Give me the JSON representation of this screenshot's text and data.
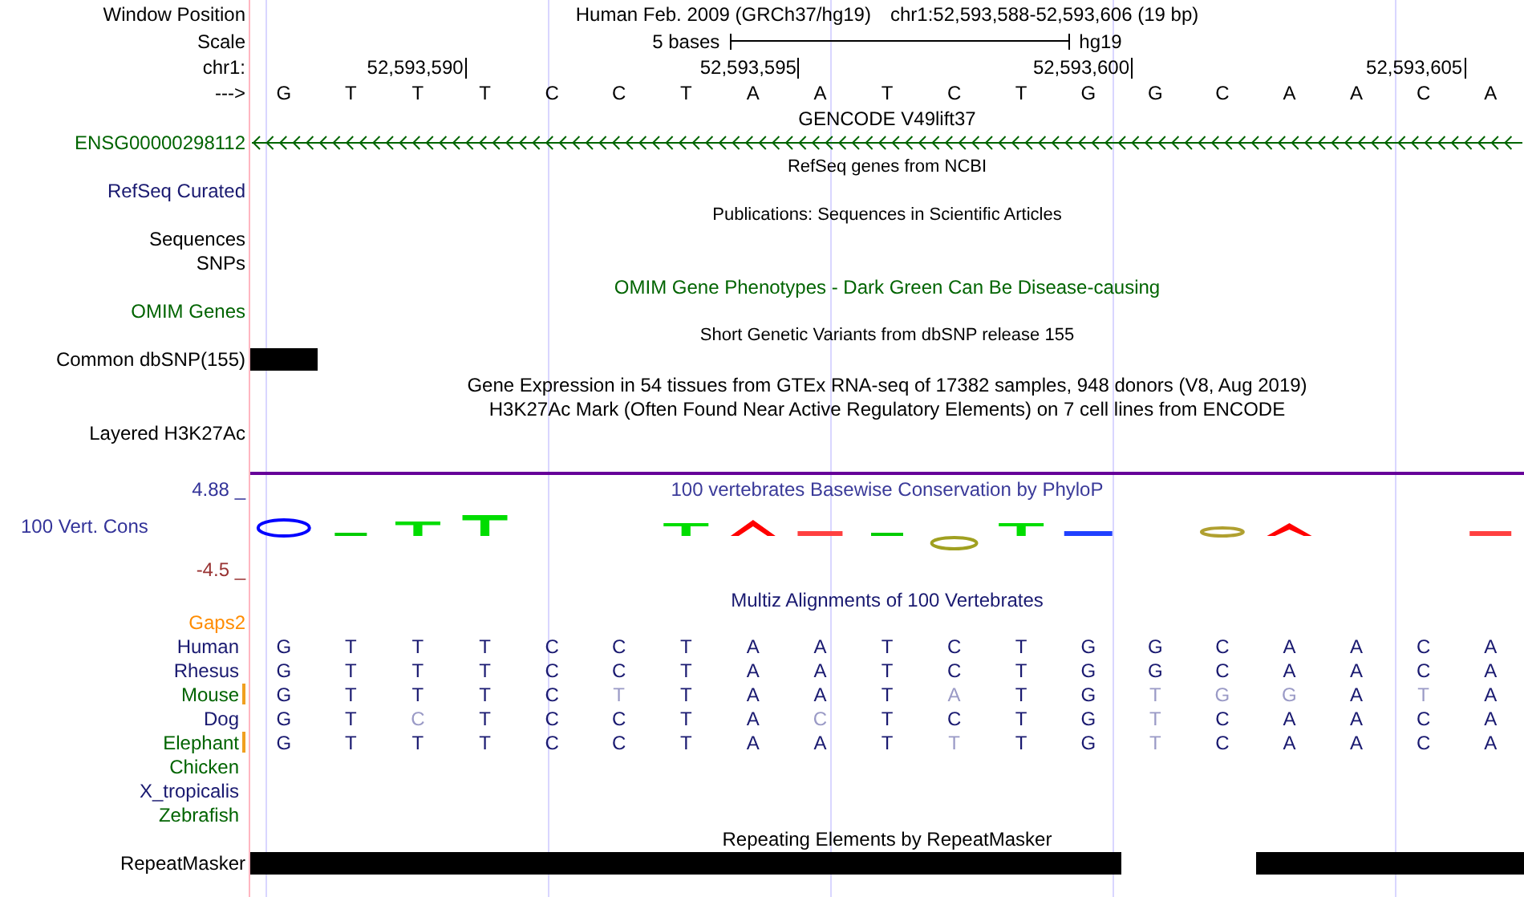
{
  "header": {
    "position_label": "Window Position",
    "assembly": "Human Feb. 2009 (GRCh37/hg19)",
    "position": "chr1:52,593,588-52,593,606 (19 bp)",
    "scale_label": "Scale",
    "scale_text": "5 bases",
    "scale_db": "hg19",
    "ruler_label": "chr1:",
    "strand_label": "--->",
    "bases": [
      {
        "base": "G"
      },
      {
        "base": "T"
      },
      {
        "base": "T",
        "tick": "52,593,590"
      },
      {
        "base": "T"
      },
      {
        "base": "C"
      },
      {
        "base": "C"
      },
      {
        "base": "T"
      },
      {
        "base": "A",
        "tick": "52,593,595"
      },
      {
        "base": "A"
      },
      {
        "base": "T"
      },
      {
        "base": "C"
      },
      {
        "base": "T"
      },
      {
        "base": "G",
        "tick": "52,593,600"
      },
      {
        "base": "G"
      },
      {
        "base": "C"
      },
      {
        "base": "A"
      },
      {
        "base": "A"
      },
      {
        "base": "C",
        "tick": "52,593,605"
      },
      {
        "base": "A"
      }
    ]
  },
  "tracks": [
    {
      "kind": "title",
      "text": "GENCODE V49lift37",
      "color": "#000000",
      "compact": false
    },
    {
      "kind": "gene",
      "label": "ENSG00000298112",
      "color": "#006400"
    },
    {
      "kind": "title",
      "text": "RefSeq genes from NCBI",
      "color": "#000000",
      "compact": true
    },
    {
      "kind": "label",
      "label": "RefSeq Curated",
      "color": "#191970"
    },
    {
      "kind": "title",
      "text": "Publications: Sequences in Scientific Articles",
      "color": "#000000",
      "compact": true
    },
    {
      "kind": "label",
      "label": "Sequences",
      "color": "#000000"
    },
    {
      "kind": "label",
      "label": "SNPs",
      "color": "#000000"
    },
    {
      "kind": "title",
      "text": "OMIM Gene Phenotypes - Dark Green Can Be Disease-causing",
      "color": "#006400",
      "compact": false
    },
    {
      "kind": "label",
      "label": "OMIM Genes",
      "color": "#006400"
    },
    {
      "kind": "title",
      "text": "Short Genetic Variants from dbSNP release 155",
      "color": "#000000",
      "compact": true
    },
    {
      "kind": "features",
      "label": "Common dbSNP(155)",
      "color": "#000000",
      "covered": [
        true,
        false,
        false,
        false,
        false,
        false,
        false,
        false,
        false,
        false,
        false,
        false,
        false,
        false,
        false,
        false,
        false,
        false,
        false
      ]
    },
    {
      "kind": "title",
      "text": "Gene Expression in 54 tissues from GTEx RNA-seq of 17382 samples, 948 donors (V8, Aug 2019)",
      "color": "#000000",
      "compact": false
    },
    {
      "kind": "title",
      "text": "H3K27Ac Mark (Often Found Near Active Regulatory Elements) on 7 cell lines from ENCODE",
      "color": "#000000",
      "compact": false
    },
    {
      "kind": "label",
      "label": "Layered H3K27Ac",
      "color": "#000000"
    },
    {
      "kind": "conservation",
      "title": "100 vertebrates Basewise Conservation by PhyloP",
      "label": "100 Vert. Cons",
      "max": "4.88 _",
      "min": "-4.5 _"
    },
    {
      "kind": "alignment",
      "title": "Multiz Alignments of 100 Vertebrates",
      "gaps_label": "Gaps2",
      "species": [
        {
          "name": "Human",
          "color": "#191970",
          "gap_marker": false,
          "bases": [
            {
              "b": "G",
              "faded": false
            },
            {
              "b": "T",
              "faded": false
            },
            {
              "b": "T",
              "faded": false
            },
            {
              "b": "T",
              "faded": false
            },
            {
              "b": "C",
              "faded": false
            },
            {
              "b": "C",
              "faded": false
            },
            {
              "b": "T",
              "faded": false
            },
            {
              "b": "A",
              "faded": false
            },
            {
              "b": "A",
              "faded": false
            },
            {
              "b": "T",
              "faded": false
            },
            {
              "b": "C",
              "faded": false
            },
            {
              "b": "T",
              "faded": false
            },
            {
              "b": "G",
              "faded": false
            },
            {
              "b": "G",
              "faded": false
            },
            {
              "b": "C",
              "faded": false
            },
            {
              "b": "A",
              "faded": false
            },
            {
              "b": "A",
              "faded": false
            },
            {
              "b": "C",
              "faded": false
            },
            {
              "b": "A",
              "faded": false
            }
          ]
        },
        {
          "name": "Rhesus",
          "color": "#191970",
          "gap_marker": false,
          "bases": [
            {
              "b": "G",
              "faded": false
            },
            {
              "b": "T",
              "faded": false
            },
            {
              "b": "T",
              "faded": false
            },
            {
              "b": "T",
              "faded": false
            },
            {
              "b": "C",
              "faded": false
            },
            {
              "b": "C",
              "faded": false
            },
            {
              "b": "T",
              "faded": false
            },
            {
              "b": "A",
              "faded": false
            },
            {
              "b": "A",
              "faded": false
            },
            {
              "b": "T",
              "faded": false
            },
            {
              "b": "C",
              "faded": false
            },
            {
              "b": "T",
              "faded": false
            },
            {
              "b": "G",
              "faded": false
            },
            {
              "b": "G",
              "faded": false
            },
            {
              "b": "C",
              "faded": false
            },
            {
              "b": "A",
              "faded": false
            },
            {
              "b": "A",
              "faded": false
            },
            {
              "b": "C",
              "faded": false
            },
            {
              "b": "A",
              "faded": false
            }
          ]
        },
        {
          "name": "Mouse",
          "color": "#006400",
          "gap_marker": true,
          "bases": [
            {
              "b": "G",
              "faded": false
            },
            {
              "b": "T",
              "faded": false
            },
            {
              "b": "T",
              "faded": false
            },
            {
              "b": "T",
              "faded": false
            },
            {
              "b": "C",
              "faded": false
            },
            {
              "b": "T",
              "faded": true
            },
            {
              "b": "T",
              "faded": false
            },
            {
              "b": "A",
              "faded": false
            },
            {
              "b": "A",
              "faded": false
            },
            {
              "b": "T",
              "faded": false
            },
            {
              "b": "A",
              "faded": true
            },
            {
              "b": "T",
              "faded": false
            },
            {
              "b": "G",
              "faded": false
            },
            {
              "b": "T",
              "faded": true
            },
            {
              "b": "G",
              "faded": true
            },
            {
              "b": "G",
              "faded": true
            },
            {
              "b": "A",
              "faded": false
            },
            {
              "b": "T",
              "faded": true
            },
            {
              "b": "A",
              "faded": false
            }
          ]
        },
        {
          "name": "Dog",
          "color": "#191970",
          "gap_marker": false,
          "bases": [
            {
              "b": "G",
              "faded": false
            },
            {
              "b": "T",
              "faded": false
            },
            {
              "b": "C",
              "faded": true
            },
            {
              "b": "T",
              "faded": false
            },
            {
              "b": "C",
              "faded": false
            },
            {
              "b": "C",
              "faded": false
            },
            {
              "b": "T",
              "faded": false
            },
            {
              "b": "A",
              "faded": false
            },
            {
              "b": "C",
              "faded": true
            },
            {
              "b": "T",
              "faded": false
            },
            {
              "b": "C",
              "faded": false
            },
            {
              "b": "T",
              "faded": false
            },
            {
              "b": "G",
              "faded": false
            },
            {
              "b": "T",
              "faded": true
            },
            {
              "b": "C",
              "faded": false
            },
            {
              "b": "A",
              "faded": false
            },
            {
              "b": "A",
              "faded": false
            },
            {
              "b": "C",
              "faded": false
            },
            {
              "b": "A",
              "faded": false
            }
          ]
        },
        {
          "name": "Elephant",
          "color": "#006400",
          "gap_marker": true,
          "bases": [
            {
              "b": "G",
              "faded": false
            },
            {
              "b": "T",
              "faded": false
            },
            {
              "b": "T",
              "faded": false
            },
            {
              "b": "T",
              "faded": false
            },
            {
              "b": "C",
              "faded": false
            },
            {
              "b": "C",
              "faded": false
            },
            {
              "b": "T",
              "faded": false
            },
            {
              "b": "A",
              "faded": false
            },
            {
              "b": "A",
              "faded": false
            },
            {
              "b": "T",
              "faded": false
            },
            {
              "b": "T",
              "faded": true
            },
            {
              "b": "T",
              "faded": false
            },
            {
              "b": "G",
              "faded": false
            },
            {
              "b": "T",
              "faded": true
            },
            {
              "b": "C",
              "faded": false
            },
            {
              "b": "A",
              "faded": false
            },
            {
              "b": "A",
              "faded": false
            },
            {
              "b": "C",
              "faded": false
            },
            {
              "b": "A",
              "faded": false
            }
          ]
        },
        {
          "name": "Chicken",
          "color": "#006400",
          "gap_marker": false
        },
        {
          "name": "X_tropicalis",
          "color": "#191970",
          "gap_marker": false
        },
        {
          "name": "Zebrafish",
          "color": "#006400",
          "gap_marker": false
        }
      ]
    },
    {
      "kind": "title",
      "text": "Repeating Elements by RepeatMasker",
      "color": "#000000",
      "compact": false
    },
    {
      "kind": "features",
      "label": "RepeatMasker",
      "color": "#000000",
      "covered": [
        true,
        true,
        true,
        true,
        true,
        true,
        true,
        true,
        true,
        true,
        true,
        true,
        true,
        false,
        false,
        true,
        true,
        true,
        true
      ]
    }
  ]
}
